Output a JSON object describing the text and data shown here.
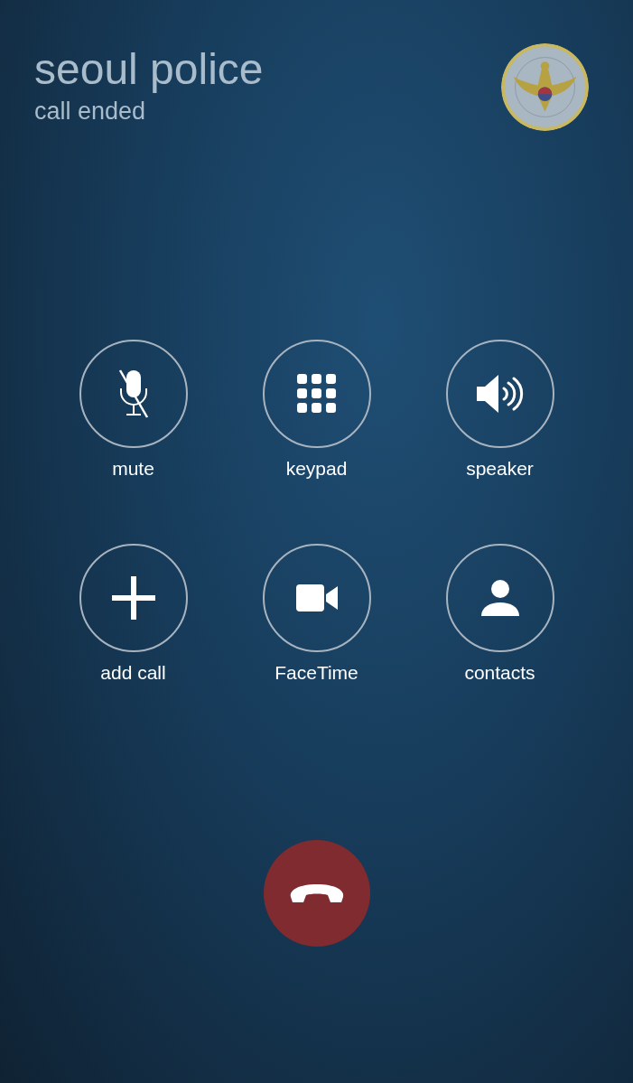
{
  "contact": {
    "name": "seoul police",
    "status": "call ended"
  },
  "controls": [
    {
      "kind": "mute",
      "label": "mute"
    },
    {
      "kind": "keypad",
      "label": "keypad"
    },
    {
      "kind": "speaker",
      "label": "speaker"
    },
    {
      "kind": "add",
      "label": "add call"
    },
    {
      "kind": "video",
      "label": "FaceTime"
    },
    {
      "kind": "contacts",
      "label": "contacts"
    }
  ],
  "end_call": {
    "kind": "hangup"
  }
}
